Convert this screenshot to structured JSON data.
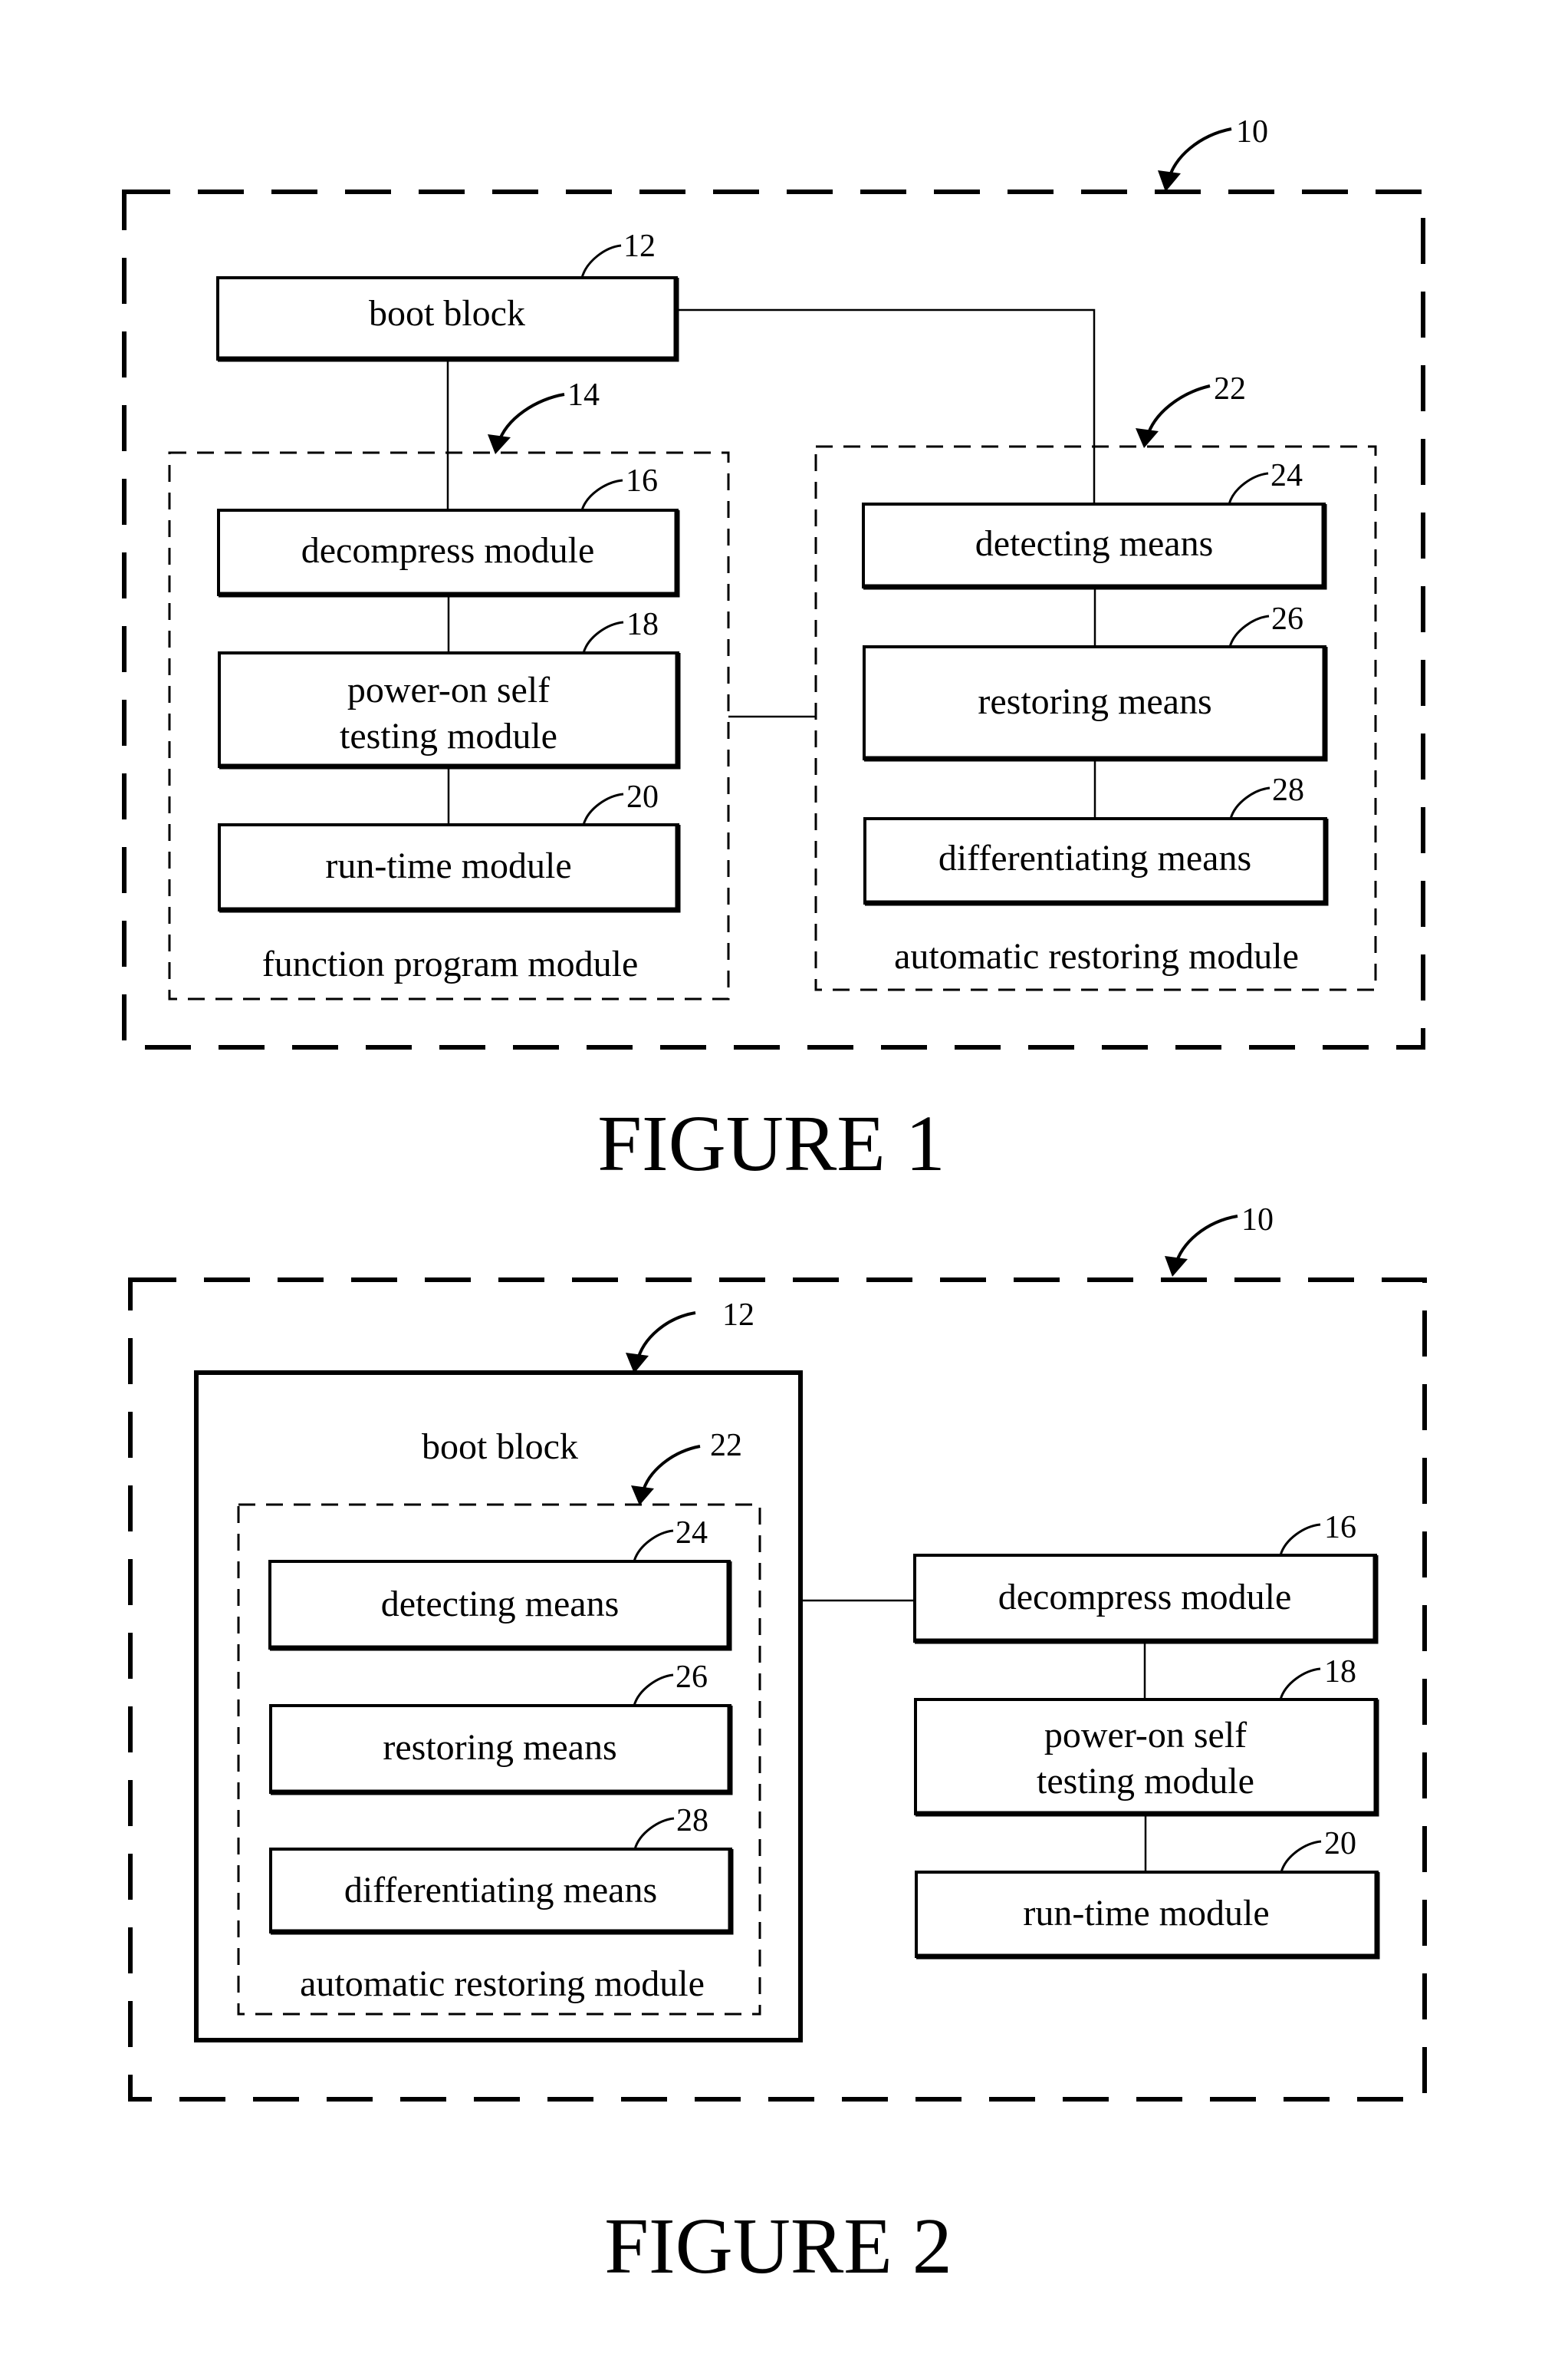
{
  "figures": [
    {
      "caption": "FIGURE 1",
      "refs": {
        "system": "10",
        "boot_block": "12",
        "function_program_module": "14",
        "decompress_module": "16",
        "post_module": "18",
        "run_time_module": "20",
        "automatic_restoring_module": "22",
        "detecting_means": "24",
        "restoring_means": "26",
        "differentiating_means": "28"
      },
      "labels": {
        "boot_block": "boot block",
        "decompress_module": "decompress module",
        "post_line1": "power-on self",
        "post_line2": "testing module",
        "run_time_module": "run-time module",
        "function_program_module": "function program module",
        "detecting_means": "detecting means",
        "restoring_means": "restoring means",
        "differentiating_means": "differentiating means",
        "automatic_restoring_module": "automatic restoring module"
      }
    },
    {
      "caption": "FIGURE 2",
      "refs": {
        "system": "10",
        "boot_block": "12",
        "automatic_restoring_module": "22",
        "detecting_means": "24",
        "restoring_means": "26",
        "differentiating_means": "28",
        "decompress_module": "16",
        "post_module": "18",
        "run_time_module": "20"
      },
      "labels": {
        "boot_block": "boot block",
        "detecting_means": "detecting means",
        "restoring_means": "restoring means",
        "differentiating_means": "differentiating means",
        "automatic_restoring_module": "automatic restoring module",
        "decompress_module": "decompress module",
        "post_line1": "power-on self",
        "post_line2": "testing module",
        "run_time_module": "run-time module"
      }
    }
  ]
}
